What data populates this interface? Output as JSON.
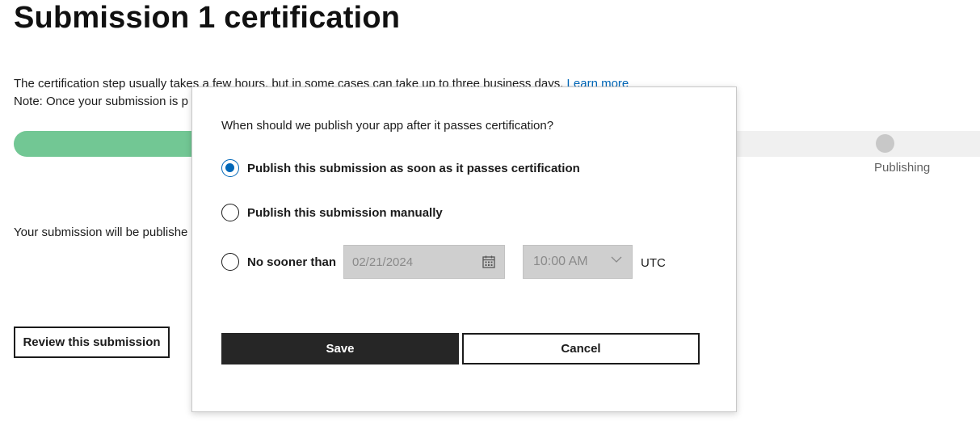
{
  "page": {
    "title": "Submission 1 certification",
    "desc_line1_text": "The certification step usually takes a few hours, but in some cases can take up to three business days.",
    "learn_more": "Learn more",
    "desc_line2_text": "Note: Once your submission is p",
    "publish_text": "Your submission will be publishe",
    "review_button": "Review this submission"
  },
  "progress": {
    "fill_percent": 20,
    "step_label": "Publishing",
    "fill_color": "#72c794",
    "track_color": "#f0f0f0"
  },
  "dialog": {
    "question": "When should we publish your app after it passes certification?",
    "options": [
      {
        "label": "Publish this submission as soon as it passes certification",
        "checked": true
      },
      {
        "label": "Publish this submission manually",
        "checked": false
      },
      {
        "label": "No sooner than",
        "checked": false
      }
    ],
    "date_value": "02/21/2024",
    "date_icon": "calendar-icon",
    "time_value": "10:00 AM",
    "time_icon": "chevron-down-icon",
    "timezone": "UTC",
    "save_label": "Save",
    "cancel_label": "Cancel",
    "accent_color": "#0067b8"
  }
}
